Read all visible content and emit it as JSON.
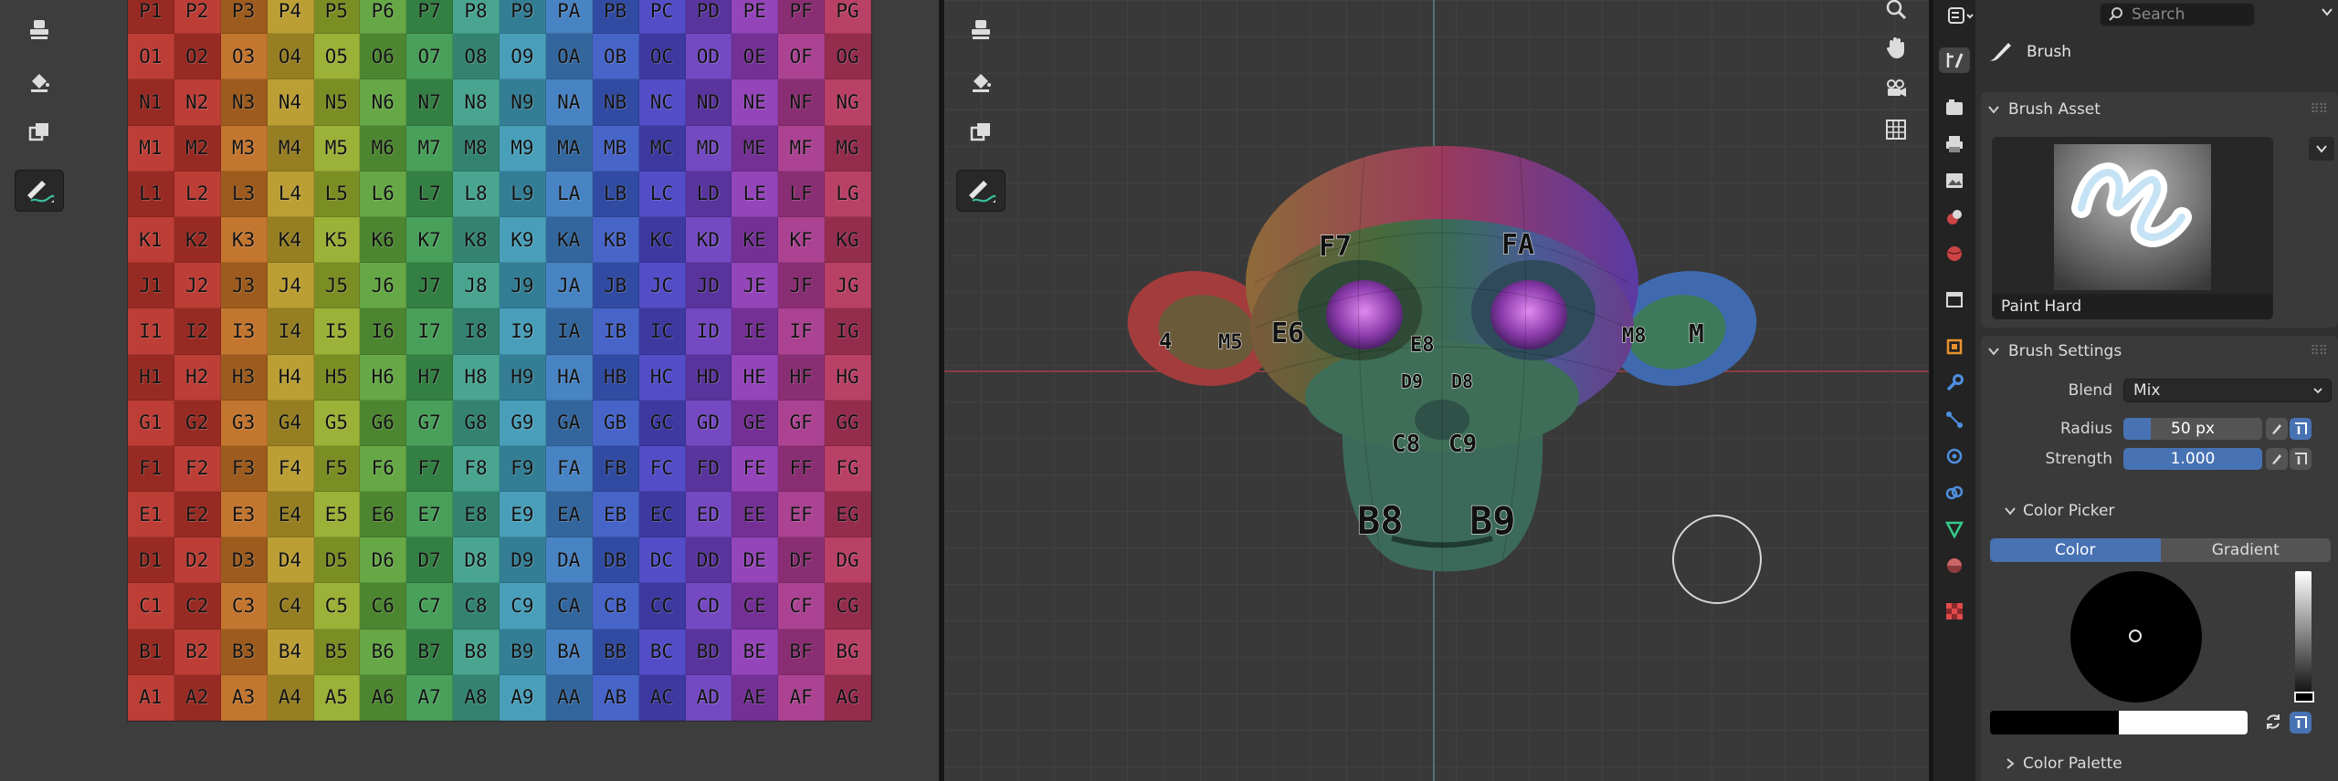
{
  "image_editor": {
    "uv_rows": [
      "P",
      "O",
      "N",
      "M",
      "L",
      "K",
      "J",
      "I",
      "H",
      "G",
      "F",
      "E",
      "D",
      "C",
      "B",
      "A"
    ],
    "uv_cols": [
      "1",
      "2",
      "3",
      "4",
      "5",
      "6",
      "7",
      "8",
      "9",
      "A",
      "B",
      "C",
      "D",
      "E",
      "F",
      "G"
    ],
    "column_colors": [
      "#b8342b",
      "#b8342b",
      "#c06f24",
      "#b79a2a",
      "#96ad2c",
      "#5ea33c",
      "#3f9b52",
      "#3fa08a",
      "#3f9ab6",
      "#3e7cc0",
      "#3d5cc6",
      "#4a45c4",
      "#6d3fbf",
      "#8e3bb6",
      "#a8388c",
      "#b5365e"
    ]
  },
  "viewport": {
    "monkey_labels": [
      "F7",
      "FA",
      "E6",
      "M5",
      "4",
      "E8",
      "D9",
      "D8",
      "C8",
      "C9",
      "B8",
      "B9",
      "M8",
      "M"
    ]
  },
  "properties": {
    "search_placeholder": "Search",
    "context_label": "Brush",
    "brush_asset": {
      "header": "Brush Asset",
      "name": "Paint Hard"
    },
    "brush_settings": {
      "header": "Brush Settings",
      "blend_label": "Blend",
      "blend_value": "Mix",
      "radius_label": "Radius",
      "radius_value": "50 px",
      "radius_fill": 0.2,
      "strength_label": "Strength",
      "strength_value": "1.000",
      "strength_fill": 1.0
    },
    "color_picker": {
      "header": "Color Picker",
      "tab_color": "Color",
      "tab_gradient": "Gradient"
    },
    "color_palette": {
      "header": "Color Palette"
    }
  }
}
